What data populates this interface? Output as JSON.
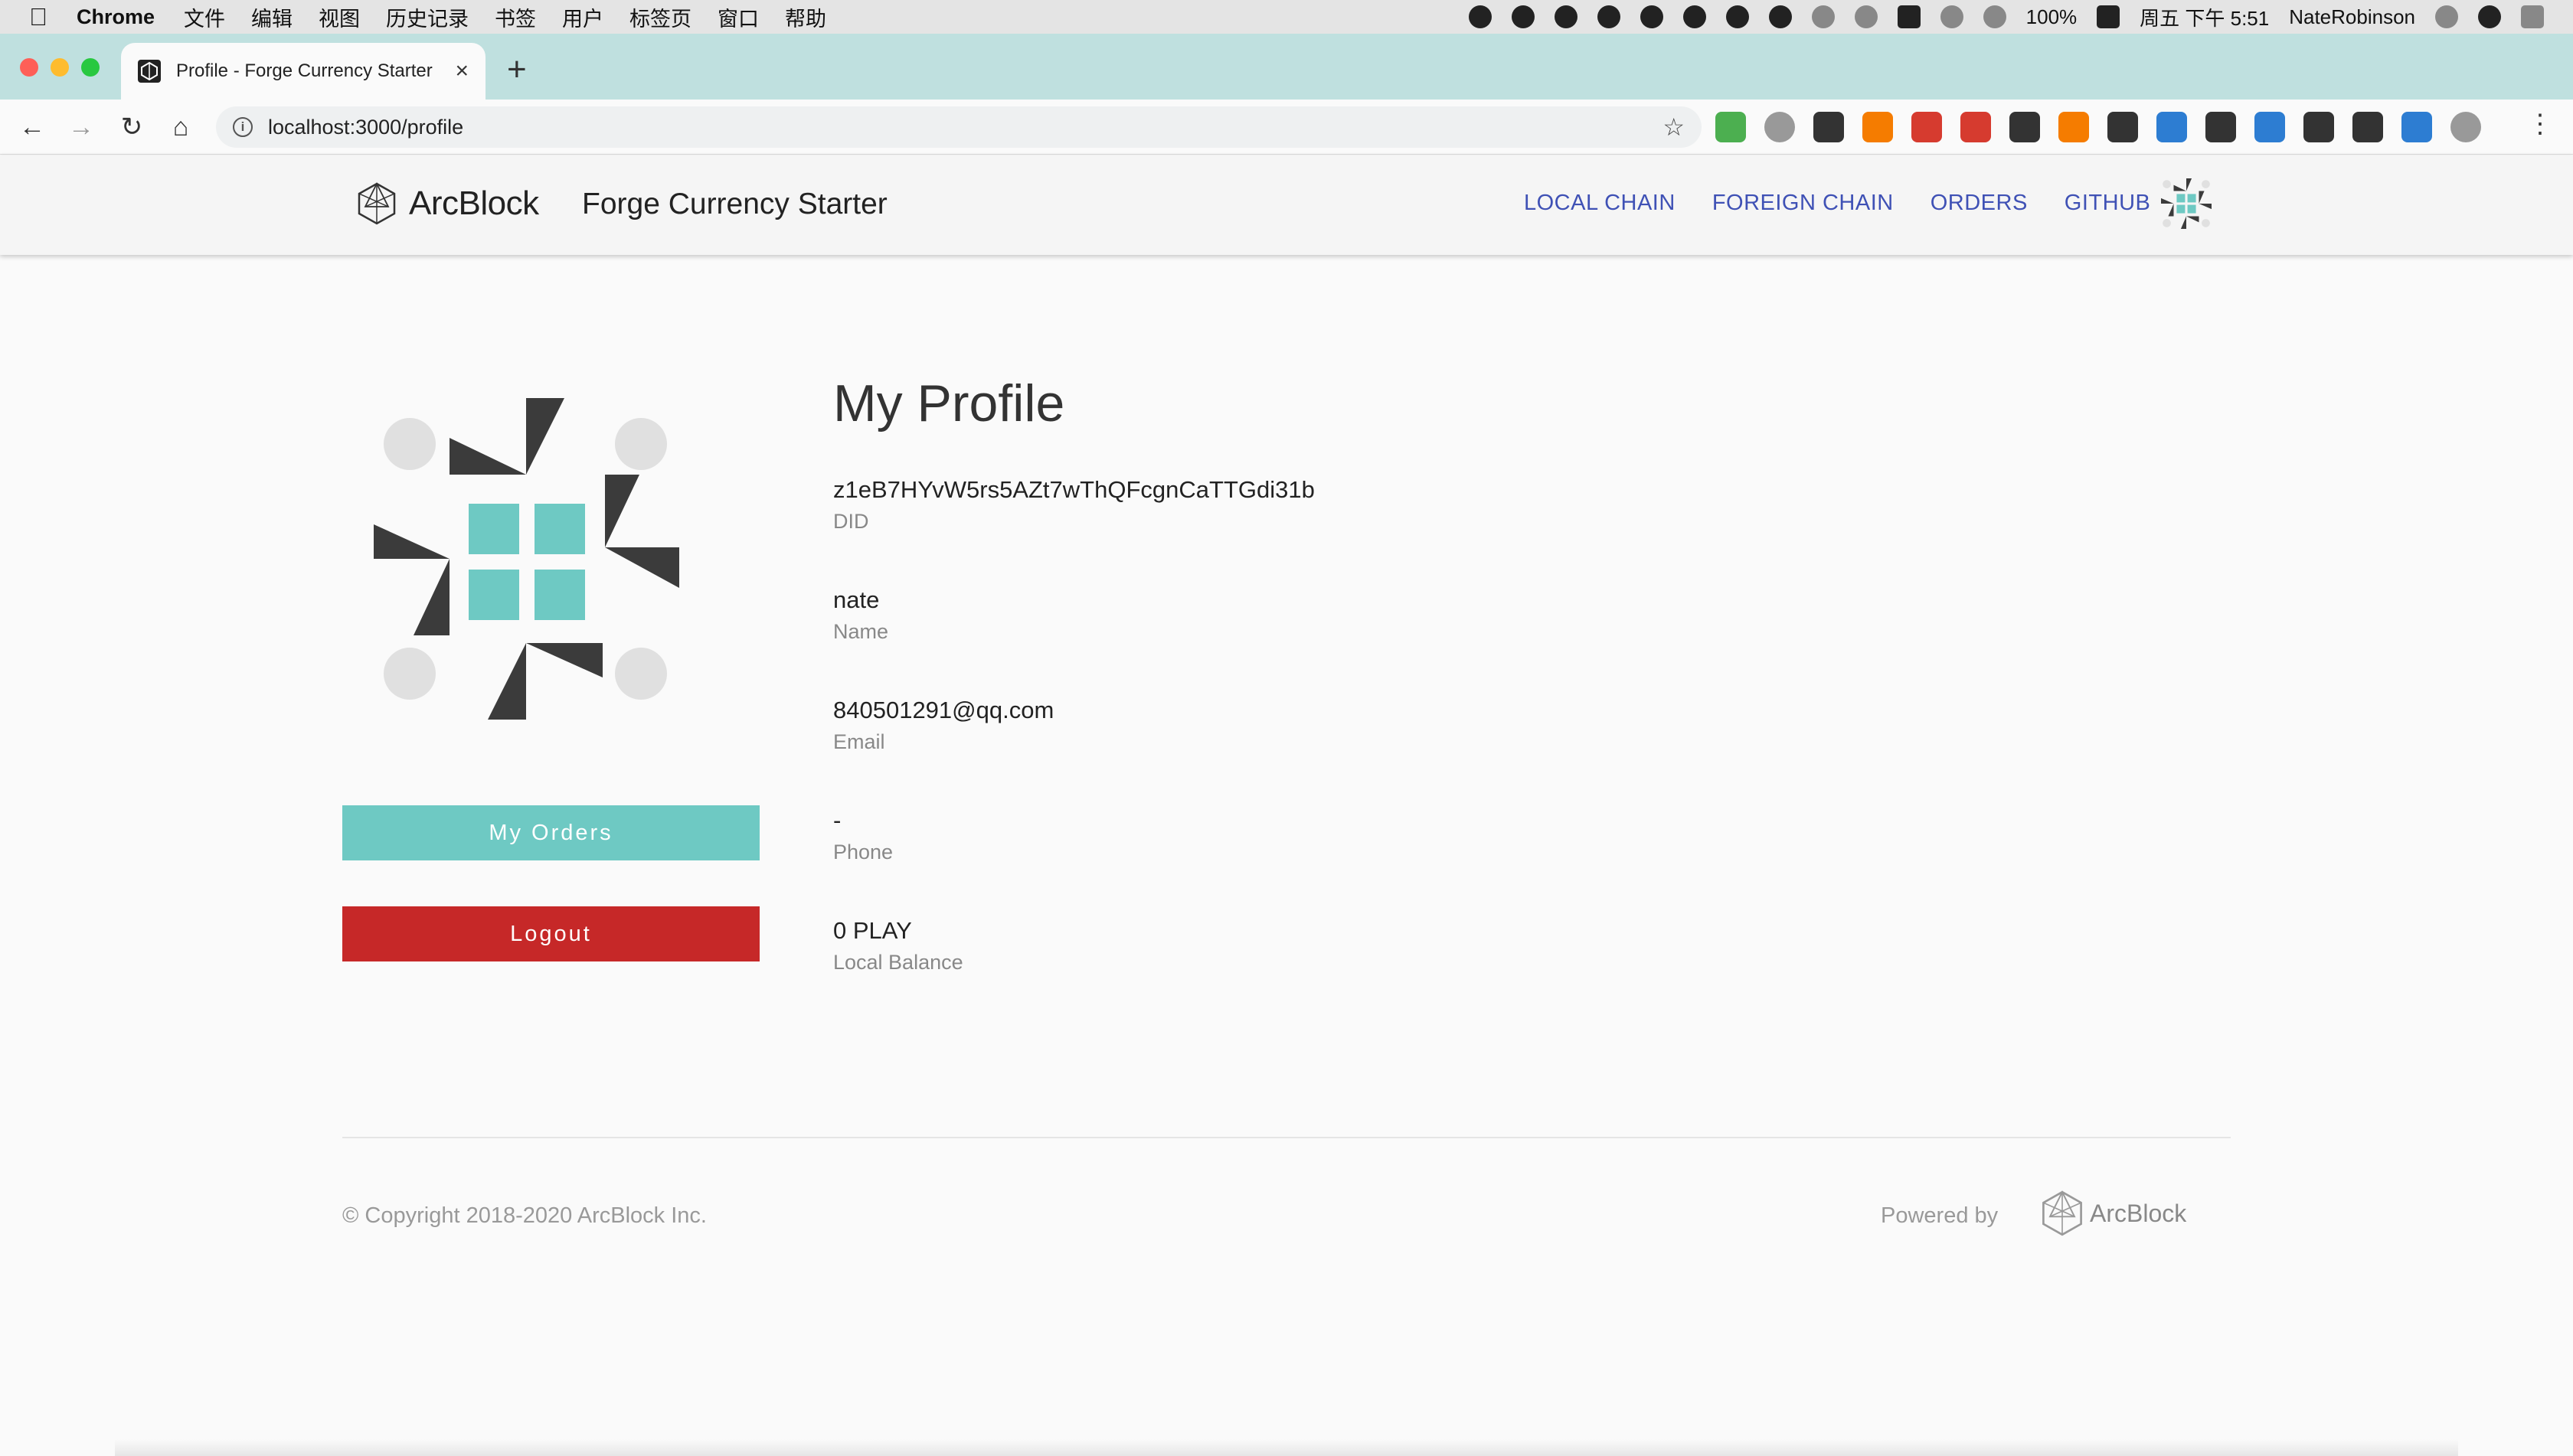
{
  "menubar": {
    "app_name": "Chrome",
    "menus": [
      "文件",
      "编辑",
      "视图",
      "历史记录",
      "书签",
      "用户",
      "标签页",
      "窗口",
      "帮助"
    ],
    "battery": "100%",
    "clock": "周五 下午 5:51",
    "user": "NateRobinson"
  },
  "browser": {
    "tab_title": "Profile - Forge Currency Starter",
    "url": "localhost:3000/profile"
  },
  "header": {
    "logo_text": "ArcBlock",
    "site_title": "Forge Currency Starter",
    "nav": [
      "LOCAL CHAIN",
      "FOREIGN CHAIN",
      "ORDERS",
      "GITHUB"
    ]
  },
  "profile": {
    "title": "My Profile",
    "fields": [
      {
        "value": "z1eB7HYvW5rs5AZt7wThQFcgnCaTTGdi31b",
        "label": "DID"
      },
      {
        "value": "nate",
        "label": "Name"
      },
      {
        "value": "840501291@qq.com",
        "label": "Email"
      },
      {
        "value": "-",
        "label": "Phone"
      },
      {
        "value": "0 PLAY",
        "label": "Local Balance"
      }
    ],
    "orders_button": "My Orders",
    "logout_button": "Logout"
  },
  "footer": {
    "copyright": "© Copyright 2018-2020  ArcBlock Inc.",
    "powered_by": "Powered by",
    "brand": "ArcBlock"
  },
  "colors": {
    "accent": "#6ec9c3",
    "logout": "#c62828",
    "nav_link": "#3f51b5"
  }
}
